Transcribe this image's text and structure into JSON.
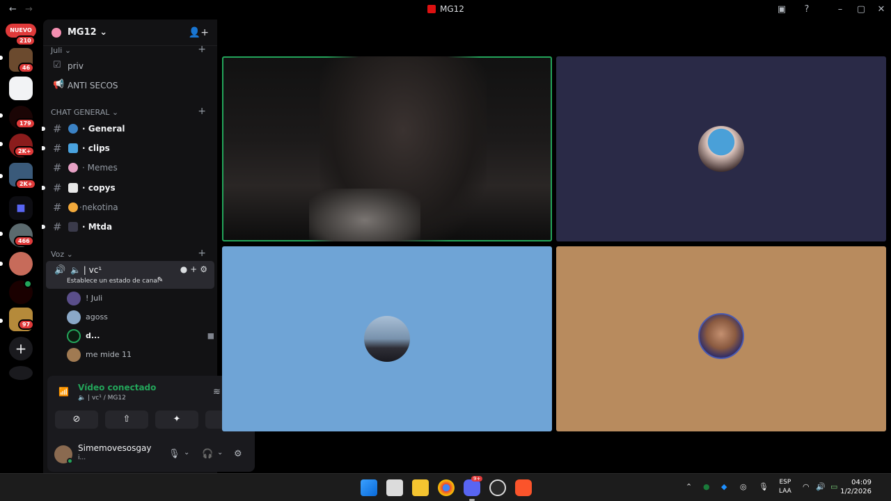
{
  "window": {
    "title": "MG12",
    "back_icon": "arrow-left",
    "forward_icon": "arrow-right",
    "help_icon": "question",
    "minimize_icon": "minimize",
    "maximize_icon": "maximize",
    "close_icon": "close"
  },
  "server_rail": {
    "new_badge": "NUEVO",
    "badges": [
      "210",
      "46",
      "179",
      "2K+",
      "2K+",
      "466",
      "97"
    ]
  },
  "guild": {
    "name": "MG12",
    "chevron": "⌄"
  },
  "categories": {
    "juli": "Juli",
    "chat_general": "CHAT GENERAL",
    "voz": "Voz"
  },
  "top_channels": [
    {
      "name": "priv"
    },
    {
      "name": "ANTI SECOS"
    }
  ],
  "channels": [
    {
      "name": "· General",
      "unread": true
    },
    {
      "name": "· clips",
      "unread": true
    },
    {
      "name": "· Memes",
      "unread": false
    },
    {
      "name": "· copys",
      "unread": true
    },
    {
      "name": "·nekotina",
      "unread": false
    },
    {
      "name": "· Mtda",
      "unread": true
    }
  ],
  "voice_channel": {
    "name": "| vc¹",
    "status_prompt": "Establece un estado de canal"
  },
  "voice_members": [
    {
      "name": "! Juli"
    },
    {
      "name": "agoss"
    },
    {
      "name": "d..."
    },
    {
      "name": "me mide 11"
    }
  ],
  "voice_panel": {
    "title": "Vídeo conectado",
    "subtitle": "| vc¹ / MG12"
  },
  "user": {
    "name": "Simemovesosgay",
    "status": "i..."
  },
  "taskbar": {
    "lang_top": "ESP",
    "lang_bottom": "LAA",
    "time": "04:09",
    "date": "1/2/2026",
    "discord_badge": "9+"
  },
  "colors": {
    "speaking_outline": "#23a55a",
    "tile_1": "#0b0b0d",
    "tile_2": "#2a2a47",
    "tile_3": "#6fa4d6",
    "tile_4": "#b88b5e"
  }
}
